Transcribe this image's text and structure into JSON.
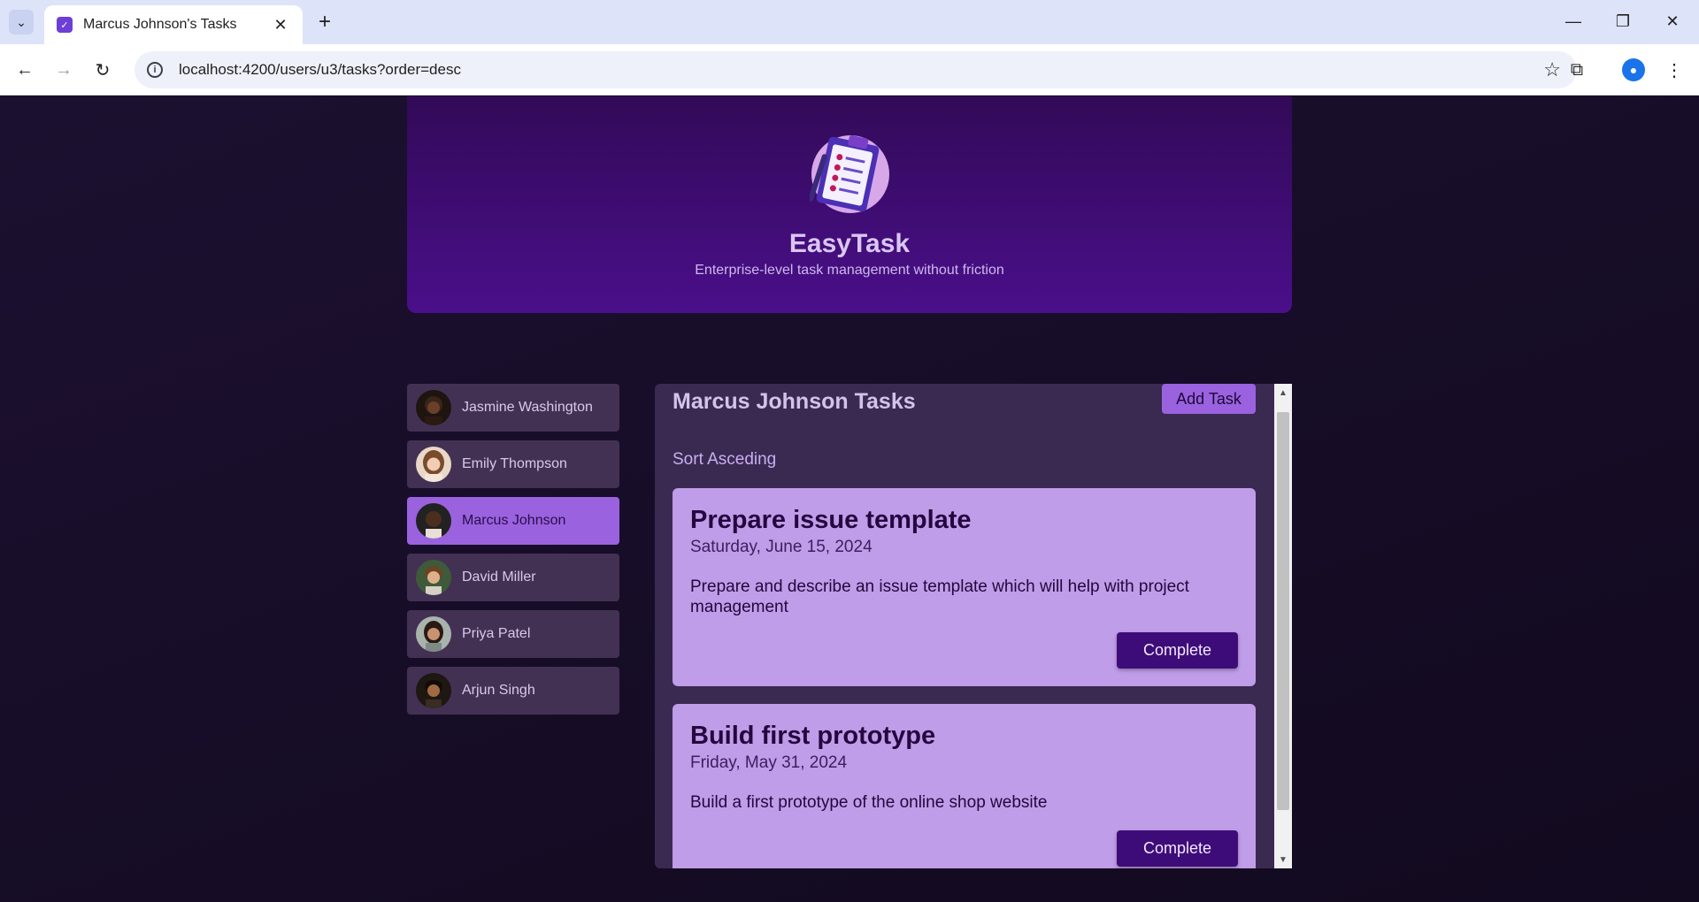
{
  "browser": {
    "tab_title": "Marcus Johnson's Tasks",
    "url": "localhost:4200/users/u3/tasks?order=desc"
  },
  "header": {
    "brand": "EasyTask",
    "tagline": "Enterprise-level task management without friction"
  },
  "users": [
    {
      "name": "Jasmine Washington",
      "active": false
    },
    {
      "name": "Emily Thompson",
      "active": false
    },
    {
      "name": "Marcus Johnson",
      "active": true
    },
    {
      "name": "David Miller",
      "active": false
    },
    {
      "name": "Priya Patel",
      "active": false
    },
    {
      "name": "Arjun Singh",
      "active": false
    }
  ],
  "tasks": {
    "title": "Marcus Johnson Tasks",
    "add_label": "Add Task",
    "sort_label": "Sort Asceding",
    "items": [
      {
        "title": "Prepare issue template",
        "date": "Saturday, June 15, 2024",
        "description": "Prepare and describe an issue template which will help with project management",
        "button": "Complete"
      },
      {
        "title": "Build first prototype",
        "date": "Friday, May 31, 2024",
        "description": "Build a first prototype of the online shop website",
        "button": "Complete"
      }
    ]
  },
  "colors": {
    "accent": "#9a62df",
    "header": "#4a0f8a",
    "card": "#bf9de8",
    "button": "#3e0c78"
  }
}
